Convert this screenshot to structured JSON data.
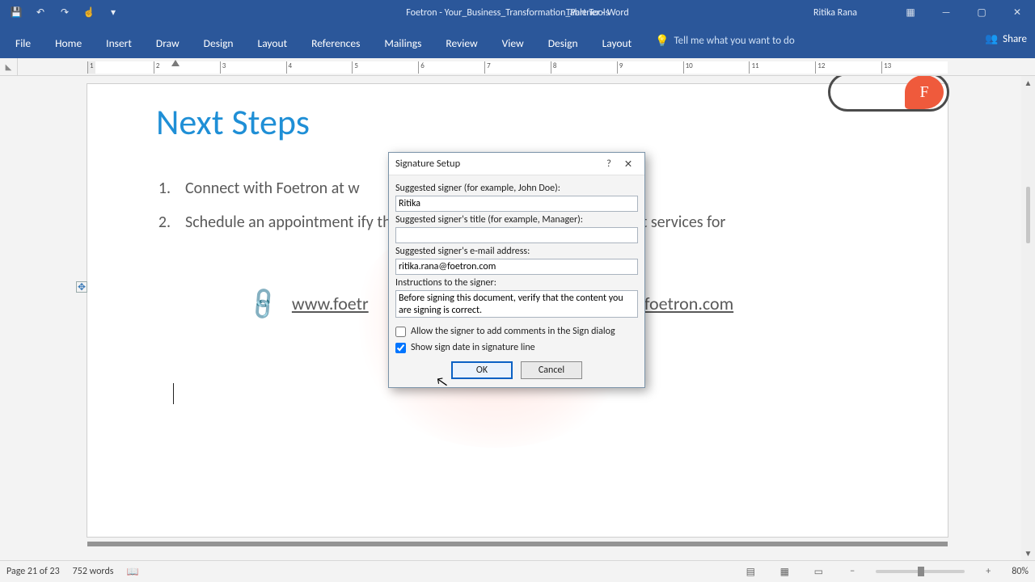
{
  "titlebar": {
    "doc_title": "Foetron - Your_Business_Transformation_Partner  -  Word",
    "context_tool": "Table Tools",
    "user_name": "Ritika Rana"
  },
  "ribbon": {
    "tabs": [
      "File",
      "Home",
      "Insert",
      "Draw",
      "Design",
      "Layout",
      "References",
      "Mailings",
      "Review",
      "View",
      "Design",
      "Layout"
    ],
    "tellme_placeholder": "Tell me what you want to do",
    "share_label": "Share"
  },
  "ruler": {
    "labels": [
      "1",
      "2",
      "3",
      "4",
      "5",
      "6",
      "7",
      "8",
      "9",
      "10",
      "11",
      "12",
      "13"
    ]
  },
  "document": {
    "heading": "Next Steps",
    "list": [
      {
        "n": "1.",
        "text": "Connect with Foetron at w"
      },
      {
        "n": "2.",
        "text": "Schedule an appointment                                                        ify the best possible Platform & Deployment services for"
      }
    ],
    "link_left": "www.foetr",
    "link_right": ".foetron.com",
    "logo_letter": "F"
  },
  "dialog": {
    "title": "Signature Setup",
    "signer_label": "Suggested signer (for example, John Doe):",
    "signer_value": "Ritika",
    "title_label": "Suggested signer's title (for example, Manager):",
    "title_value": "",
    "email_label": "Suggested signer's e-mail address:",
    "email_value": "ritika.rana@foetron.com",
    "instructions_label": "Instructions to the signer:",
    "instructions_value": "Before signing this document, verify that the content you are signing is correct.",
    "allow_comments_label": "Allow the signer to add comments in the Sign dialog",
    "allow_comments_checked": false,
    "show_date_label": "Show sign date in signature line",
    "show_date_checked": true,
    "ok_label": "OK",
    "cancel_label": "Cancel"
  },
  "status": {
    "page": "Page 21 of 23",
    "words": "752 words",
    "zoom": "80%"
  }
}
